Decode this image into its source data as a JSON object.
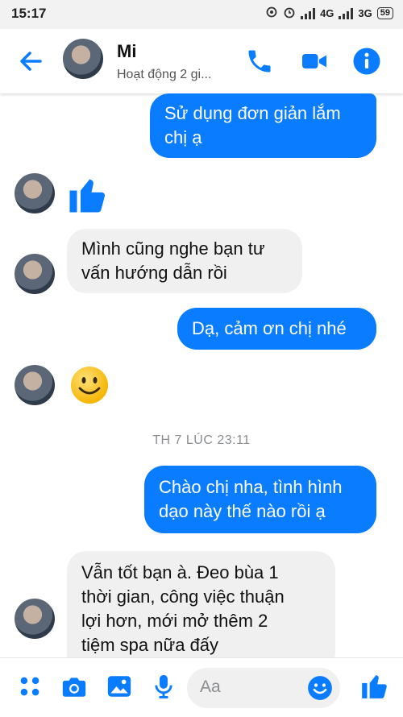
{
  "status_bar": {
    "time": "15:17",
    "network1": "4G",
    "network2": "3G",
    "battery": "59"
  },
  "header": {
    "name": "Mi",
    "status": "Hoạt động 2 gi...",
    "icons": [
      "back-arrow-icon",
      "phone-icon",
      "video-icon",
      "info-icon"
    ]
  },
  "messages": [
    {
      "direction": "outgoing",
      "text": "Sử dụng đơn giản lắm\nchị ạ"
    },
    {
      "direction": "incoming",
      "sticker": "thumbs-up"
    },
    {
      "direction": "incoming",
      "text": "Mình cũng nghe bạn tư\nvấn hướng dẫn rồi"
    },
    {
      "direction": "outgoing",
      "text": "Dạ, cảm ơn chị nhé"
    },
    {
      "direction": "incoming",
      "sticker": "smiley"
    },
    {
      "direction": "outgoing",
      "text": "Chào chị nha, tình hình\ndạo này thế nào rồi ạ"
    },
    {
      "direction": "incoming",
      "text": "Vẫn tốt bạn à. Đeo bùa 1\nthời gian, công việc thuận\nlợi hơn, mới mở thêm 2\ntiệm spa nữa đấy"
    }
  ],
  "timestamp": "TH 7 LÚC 23:11",
  "composer": {
    "placeholder": "Aa",
    "icons": [
      "grid-menu-icon",
      "camera-icon",
      "image-icon",
      "microphone-icon",
      "emoji-icon",
      "like-icon"
    ]
  },
  "colors": {
    "accent": "#0a7cff",
    "incoming_bubble": "#f0f0f0"
  }
}
